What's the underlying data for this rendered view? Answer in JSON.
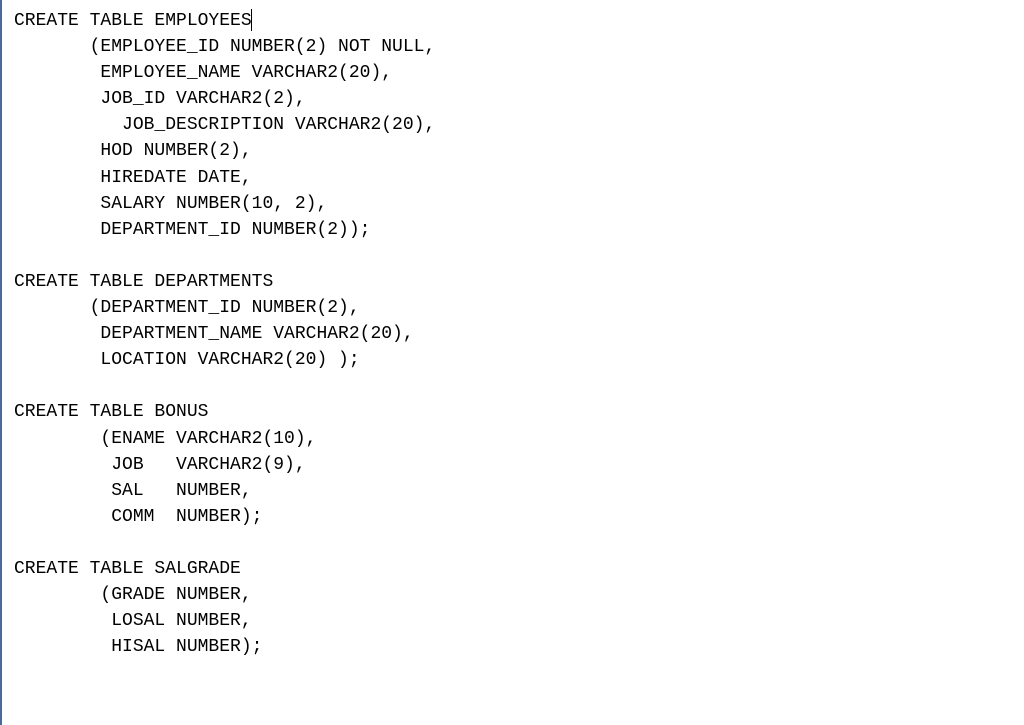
{
  "code_lines": [
    "CREATE TABLE EMPLOYEES",
    "       (EMPLOYEE_ID NUMBER(2) NOT NULL,",
    "        EMPLOYEE_NAME VARCHAR2(20),",
    "        JOB_ID VARCHAR2(2),",
    "          JOB_DESCRIPTION VARCHAR2(20),",
    "        HOD NUMBER(2),",
    "        HIREDATE DATE,",
    "        SALARY NUMBER(10, 2),",
    "        DEPARTMENT_ID NUMBER(2));",
    "",
    "CREATE TABLE DEPARTMENTS",
    "       (DEPARTMENT_ID NUMBER(2),",
    "        DEPARTMENT_NAME VARCHAR2(20),",
    "        LOCATION VARCHAR2(20) );",
    "",
    "CREATE TABLE BONUS",
    "        (ENAME VARCHAR2(10),",
    "         JOB   VARCHAR2(9),",
    "         SAL   NUMBER,",
    "         COMM  NUMBER);",
    "",
    "CREATE TABLE SALGRADE",
    "        (GRADE NUMBER,",
    "         LOSAL NUMBER,",
    "         HISAL NUMBER);"
  ],
  "cursor_line_index": 0
}
